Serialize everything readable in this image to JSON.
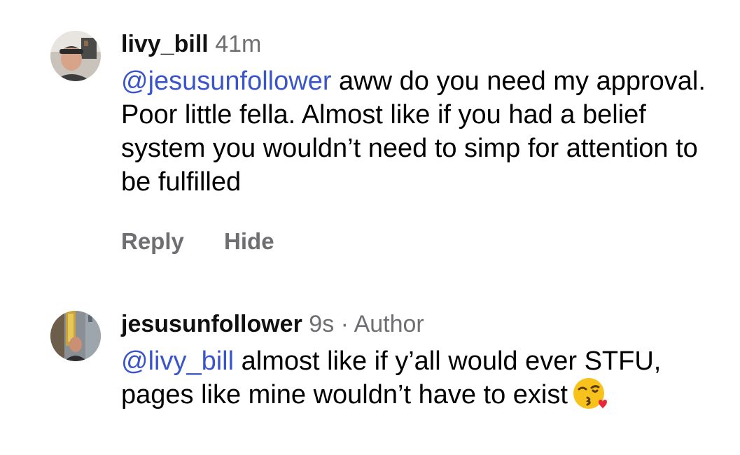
{
  "comments": [
    {
      "username": "livy_bill",
      "time": "41m",
      "author_label": "",
      "mention": "@jesusunfollower",
      "text": " aww do you need my approval. Poor little fella. Almost like if you had a belief system you wouldn’t need to simp for attention to be fulfilled",
      "reply_label": "Reply",
      "hide_label": "Hide"
    },
    {
      "username": "jesusunfollower",
      "time": "9s",
      "separator": "·",
      "author_label": "Author",
      "mention": "@livy_bill",
      "text": " almost like if y’all would ever STFU, pages like mine wouldn’t have to exist",
      "emoji": "face-blowing-a-kiss"
    }
  ],
  "colors": {
    "mention": "#3a55c8",
    "secondary_text": "#6e6e73",
    "background": "#ffffff"
  }
}
